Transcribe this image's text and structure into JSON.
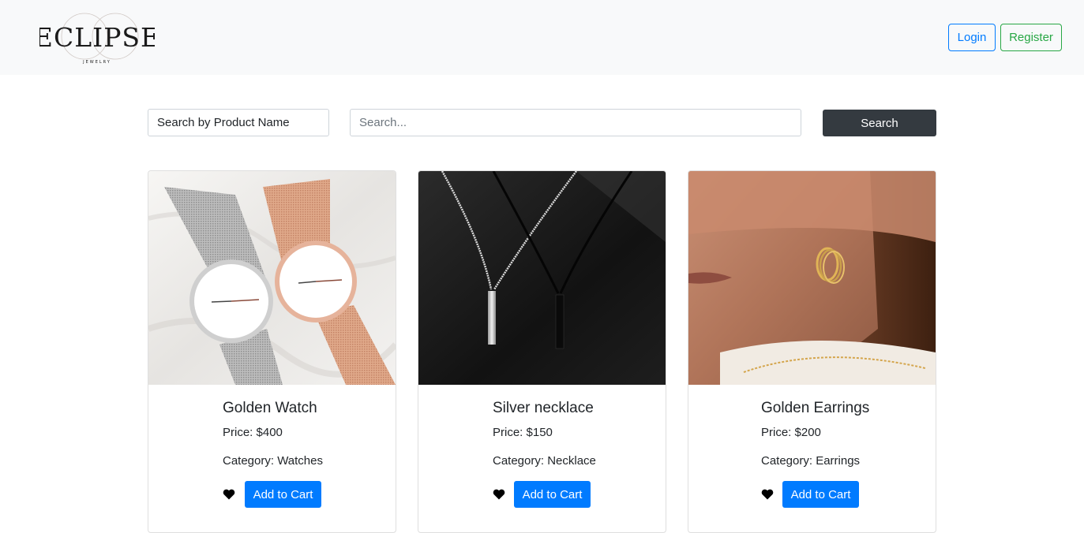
{
  "brand": {
    "logo_text": "ECLIPSE",
    "logo_subtext": "JEWELRY"
  },
  "nav": {
    "login_label": "Login",
    "register_label": "Register"
  },
  "search": {
    "filter_selected": "Search by Product Name",
    "placeholder": "Search...",
    "button_label": "Search"
  },
  "products": [
    {
      "title": "Golden Watch",
      "price": "Price: $400",
      "category": "Category: Watches",
      "cart_label": "Add to Cart"
    },
    {
      "title": "Silver necklace",
      "price": "Price: $150",
      "category": "Category: Necklace",
      "cart_label": "Add to Cart"
    },
    {
      "title": "Golden Earrings",
      "price": "Price: $200",
      "category": "Category: Earrings",
      "cart_label": "Add to Cart"
    }
  ],
  "icons": {
    "favorite": "heart-icon"
  },
  "colors": {
    "primary": "#007bff",
    "success": "#28a745",
    "dark": "#343a40",
    "navbar_bg": "#f8f9fa"
  }
}
